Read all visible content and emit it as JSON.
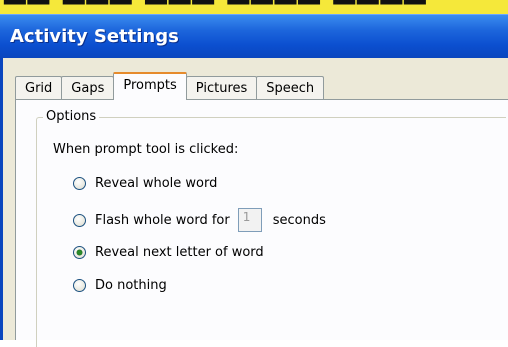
{
  "window": {
    "title": "Activity Settings"
  },
  "tabs": [
    {
      "label": "Grid",
      "active": false
    },
    {
      "label": "Gaps",
      "active": false
    },
    {
      "label": "Prompts",
      "active": true
    },
    {
      "label": "Pictures",
      "active": false
    },
    {
      "label": "Speech",
      "active": false
    }
  ],
  "options_group": {
    "legend": "Options",
    "prompt_label": "When prompt tool is clicked:",
    "radios": [
      {
        "label": "Reveal whole word",
        "checked": false
      },
      {
        "label": "Flash whole word for",
        "checked": false,
        "suffix": "seconds"
      },
      {
        "label": "Reveal next letter of word",
        "checked": true
      },
      {
        "label": "Do nothing",
        "checked": false
      }
    ],
    "seconds_value": "1"
  },
  "colors": {
    "title_bar": "#0b4fd0",
    "dialog_bg": "#ece9d8",
    "active_tab_accent": "#e68b2c",
    "radio_dot": "#2a8a2a"
  }
}
